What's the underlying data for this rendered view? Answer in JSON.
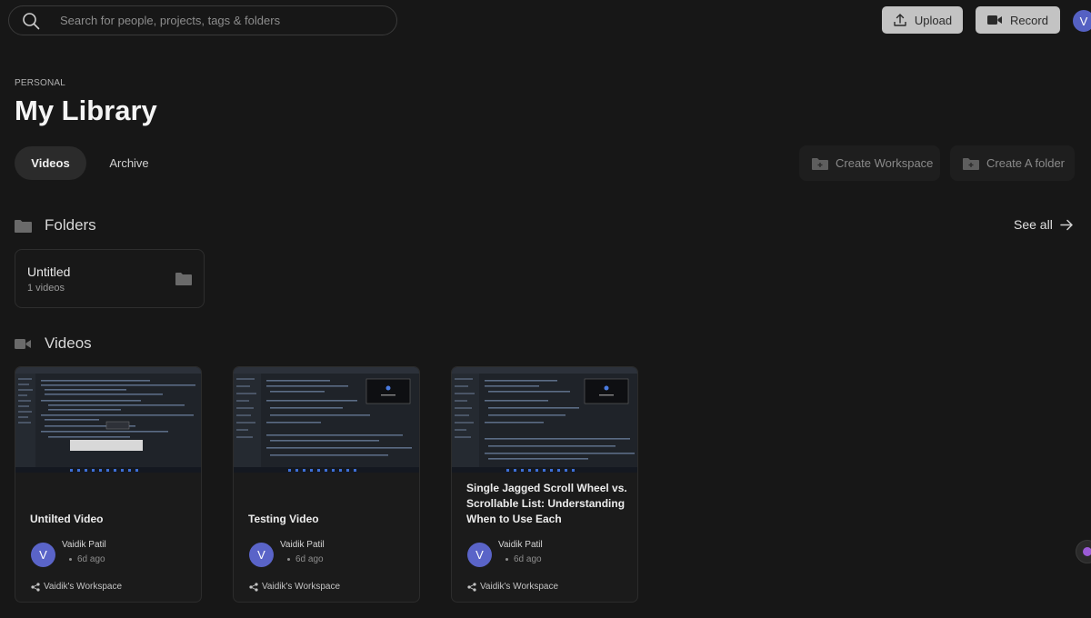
{
  "search": {
    "placeholder": "Search for people, projects, tags & folders"
  },
  "toolbar": {
    "upload_label": "Upload",
    "record_label": "Record",
    "avatar_initial": "V"
  },
  "library": {
    "eyebrow": "PERSONAL",
    "title": "My Library",
    "tabs": [
      {
        "label": "Videos",
        "active": true
      },
      {
        "label": "Archive",
        "active": false
      }
    ],
    "create_workspace_label": "Create Workspace",
    "create_folder_label": "Create A folder"
  },
  "folders": {
    "heading": "Folders",
    "see_all": "See all",
    "items": [
      {
        "name": "Untitled",
        "count": "1 videos"
      }
    ]
  },
  "videos": {
    "heading": "Videos",
    "items": [
      {
        "title": "Untilted Video",
        "author": "Vaidik Patil",
        "avatar_initial": "V",
        "time": "6d ago",
        "workspace": "Vaidik's Workspace"
      },
      {
        "title": "Testing Video",
        "author": "Vaidik Patil",
        "avatar_initial": "V",
        "time": "6d ago",
        "workspace": "Vaidik's Workspace"
      },
      {
        "title": "Single Jagged Scroll Wheel vs. Scrollable List: Understanding When to Use Each",
        "author": "Vaidik Patil",
        "avatar_initial": "V",
        "time": "6d ago",
        "workspace": "Vaidik's Workspace"
      }
    ]
  },
  "colors": {
    "background": "#171717",
    "avatar": "#5561c3",
    "button_light": "#c3c3c3"
  }
}
